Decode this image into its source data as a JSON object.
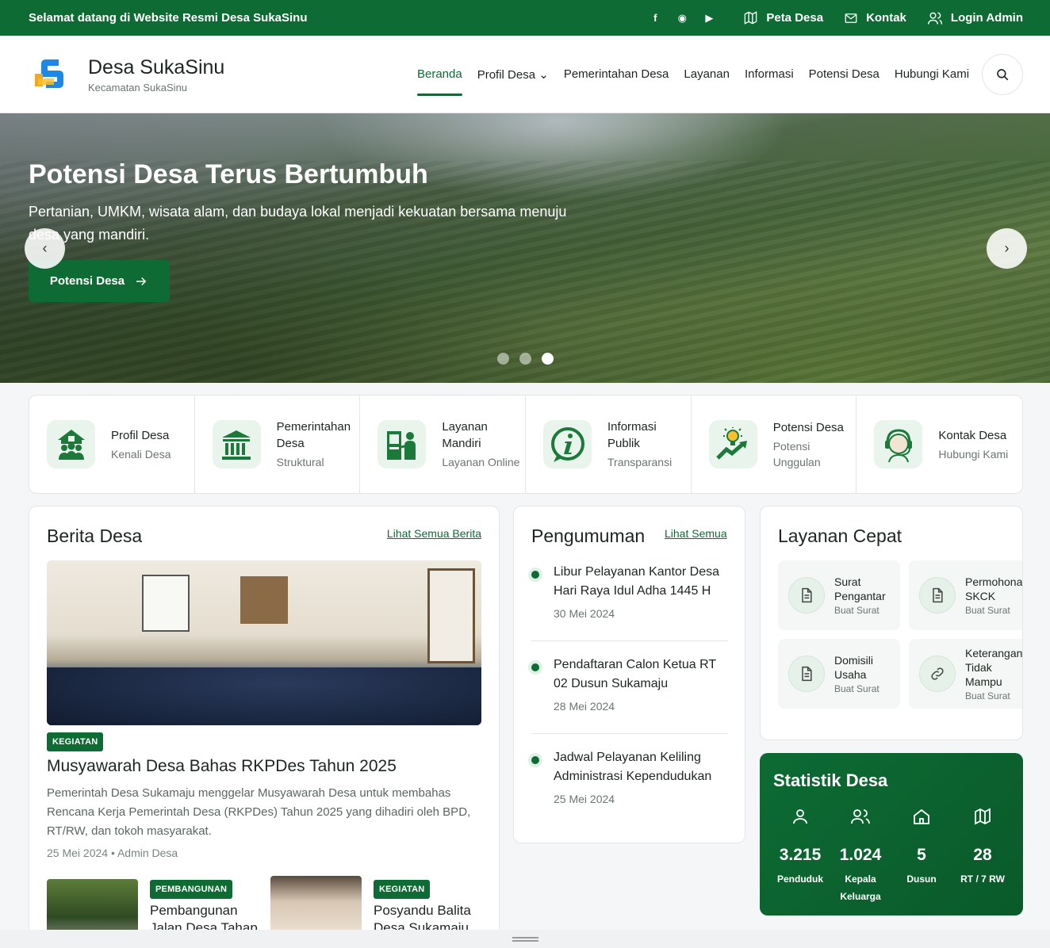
{
  "topbar": {
    "welcome": "Selamat datang di Website Resmi Desa SukaSinu",
    "social": [
      "f",
      "◉",
      "▶"
    ],
    "links": [
      {
        "label": "Peta Desa",
        "icon": "map-icon"
      },
      {
        "label": "Kontak",
        "icon": "mail-icon"
      },
      {
        "label": "Login Admin",
        "icon": "user-group-icon"
      }
    ]
  },
  "header": {
    "title": "Desa SukaSinu",
    "subtitle": "Kecamatan SukaSinu",
    "nav": [
      {
        "label": "Beranda",
        "active": true
      },
      {
        "label": "Profil Desa",
        "dropdown": true
      },
      {
        "label": "Pemerintahan Desa"
      },
      {
        "label": "Layanan"
      },
      {
        "label": "Informasi"
      },
      {
        "label": "Potensi Desa"
      },
      {
        "label": "Hubungi Kami"
      }
    ],
    "dropdown_caret": "⌄"
  },
  "hero": {
    "title": "Potensi Desa Terus Bertumbuh",
    "text": "Pertanian, UMKM, wisata alam, dan budaya lokal menjadi kekuatan bersama menuju desa yang mandiri.",
    "button": "Potensi Desa",
    "prev": "‹",
    "next": "›",
    "slide_count": 3,
    "active_slide": 3
  },
  "quick_menu": [
    {
      "title": "Profil Desa",
      "sub": "Kenali Desa",
      "icon": "village-people-icon"
    },
    {
      "title": "Pemerintahan Desa",
      "sub": "Struktural",
      "icon": "government-building-icon"
    },
    {
      "title": "Layanan Mandiri",
      "sub": "Layanan Online",
      "icon": "kiosk-icon"
    },
    {
      "title": "Informasi Publik",
      "sub": "Transparansi",
      "icon": "info-icon"
    },
    {
      "title": "Potensi Desa",
      "sub": "Potensi Unggulan",
      "icon": "growth-idea-icon"
    },
    {
      "title": "Kontak Desa",
      "sub": "Hubungi Kami",
      "icon": "headset-icon"
    }
  ],
  "news": {
    "title": "Berita Desa",
    "link": "Lihat Semua Berita",
    "main": {
      "badge": "KEGIATAN",
      "headline": "Musyawarah Desa Bahas RKPDes Tahun 2025",
      "excerpt": "Pemerintah Desa Sukamaju menggelar Musyawarah Desa untuk membahas Rencana Kerja Pemerintah Desa (RKPDes) Tahun 2025 yang dihadiri oleh BPD, RT/RW, dan tokoh masyarakat.",
      "meta": "25 Mei 2024 • Admin Desa"
    },
    "minis": [
      {
        "badge": "PEMBANGUNAN",
        "headline": "Pembangunan Jalan Desa Tahap"
      },
      {
        "badge": "KEGIATAN",
        "headline": "Posyandu Balita Desa Sukamaju"
      }
    ]
  },
  "announcements": {
    "title": "Pengumuman",
    "link": "Lihat Semua",
    "items": [
      {
        "title": "Libur Pelayanan Kantor Desa Hari Raya Idul Adha 1445 H",
        "date": "30 Mei 2024"
      },
      {
        "title": "Pendaftaran Calon Ketua RT 02 Dusun Sukamaju",
        "date": "28 Mei 2024"
      },
      {
        "title": "Jadwal Pelayanan Keliling Administrasi Kependudukan",
        "date": "25 Mei 2024"
      }
    ]
  },
  "services": {
    "title": "Layanan Cepat",
    "items": [
      {
        "name": "Surat Pengantar",
        "sub": "Buat Surat",
        "icon": "document-icon"
      },
      {
        "name": "Permohonan SKCK",
        "sub": "Buat Surat",
        "icon": "document-icon"
      },
      {
        "name": "Domisili Usaha",
        "sub": "Buat Surat",
        "icon": "document-icon"
      },
      {
        "name": "Keterangan Tidak Mampu",
        "sub": "Buat Surat",
        "icon": "link-icon"
      }
    ]
  },
  "stats": {
    "title": "Statistik Desa",
    "items": [
      {
        "value": "3.215",
        "label": "Penduduk",
        "icon": "person-icon"
      },
      {
        "value": "1.024",
        "label": "Kepala Keluarga",
        "icon": "family-icon"
      },
      {
        "value": "5",
        "label": "Dusun",
        "icon": "home-icon"
      },
      {
        "value": "28",
        "label": "RT / 7 RW",
        "icon": "map-icon"
      }
    ]
  },
  "colors": {
    "primary": "#0d6b33",
    "primary_light": "#e9f4ec",
    "text": "#1d2520",
    "muted": "#6b7570"
  }
}
